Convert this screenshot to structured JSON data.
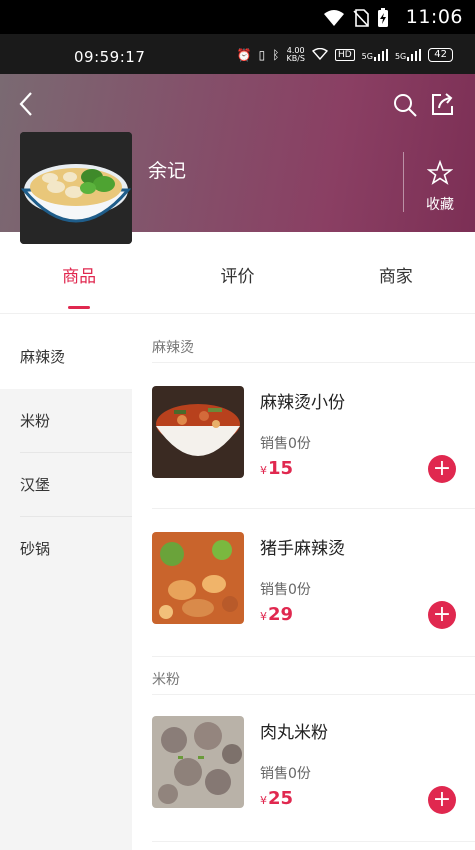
{
  "system_status": {
    "time": "11:06",
    "icons": [
      "wifi-icon",
      "no-sim-icon",
      "battery-charging-icon"
    ]
  },
  "phone_status": {
    "time": "09:59:17",
    "net_speed_top": "4.00",
    "net_speed_bottom": "KB/S",
    "hd_label": "HD",
    "signal_label_1": "5G",
    "signal_label_2": "5G",
    "battery": "42"
  },
  "header": {
    "shop_name": "余记",
    "favorite_label": "收藏",
    "icons": [
      "back-icon",
      "search-icon",
      "share-icon",
      "star-icon"
    ]
  },
  "tabs": [
    {
      "label": "商品",
      "active": true
    },
    {
      "label": "评价",
      "active": false
    },
    {
      "label": "商家",
      "active": false
    }
  ],
  "categories": [
    {
      "label": "麻辣烫",
      "active": true
    },
    {
      "label": "米粉",
      "active": false
    },
    {
      "label": "汉堡",
      "active": false
    },
    {
      "label": "砂锅",
      "active": false
    }
  ],
  "sections": [
    {
      "title": "麻辣烫",
      "items": [
        {
          "name": "麻辣烫小份",
          "sales": "销售0份",
          "currency": "¥",
          "price": "15"
        },
        {
          "name": "猪手麻辣烫",
          "sales": "销售0份",
          "currency": "¥",
          "price": "29"
        }
      ]
    },
    {
      "title": "米粉",
      "items": [
        {
          "name": "肉丸米粉",
          "sales": "销售0份",
          "currency": "¥",
          "price": "25"
        }
      ]
    }
  ],
  "colors": {
    "accent": "#e0284f",
    "header_gradient_start": "#7a6a72",
    "header_gradient_end": "#7c2f55"
  }
}
